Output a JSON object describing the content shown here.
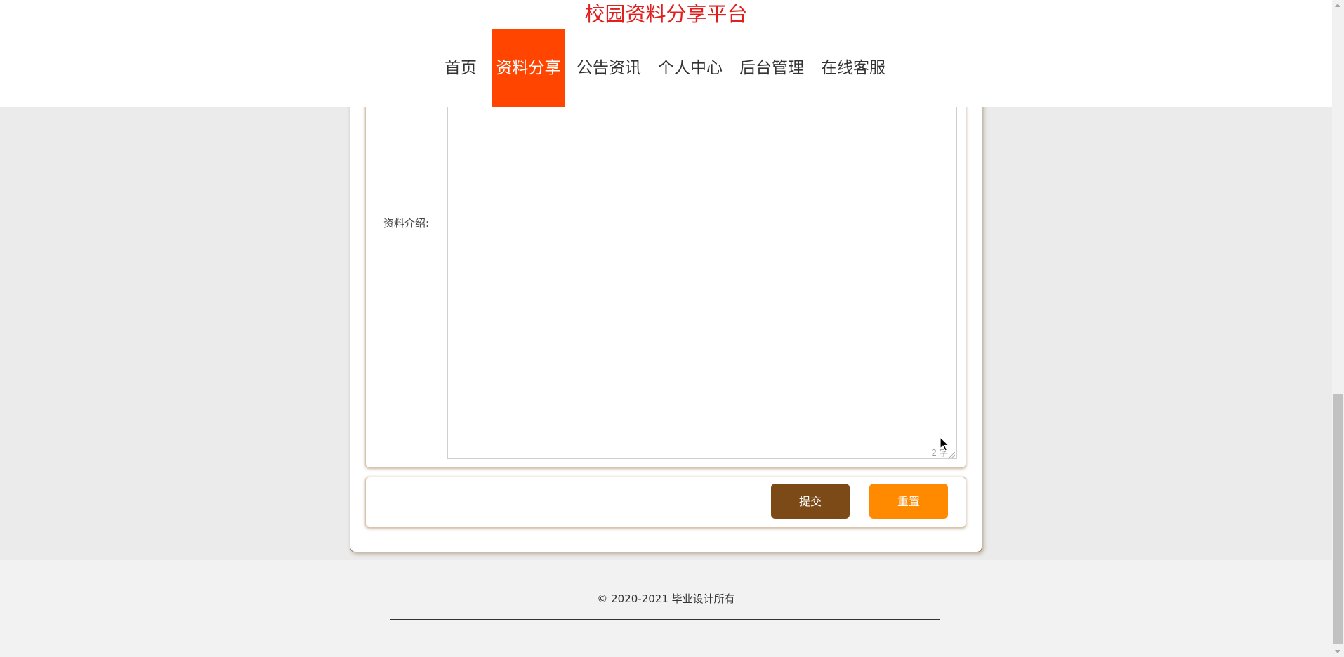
{
  "header": {
    "site_title": "校园资料分享平台",
    "nav": [
      {
        "label": "首页",
        "active": false
      },
      {
        "label": "资料分享",
        "active": true
      },
      {
        "label": "公告资讯",
        "active": false
      },
      {
        "label": "个人中心",
        "active": false
      },
      {
        "label": "后台管理",
        "active": false
      },
      {
        "label": "在线客服",
        "active": false
      }
    ],
    "accent_color": "#ff4500",
    "title_color": "#e0201f"
  },
  "form": {
    "intro_label": "资料介绍:",
    "editor_value": "",
    "word_count": "2 字",
    "submit_label": "提交",
    "reset_label": "重置",
    "submit_color": "#7b4a17",
    "reset_color": "#ff8a00"
  },
  "footer": {
    "copyright": "© 2020-2021 毕业设计所有"
  },
  "icons": {
    "cursor": "arrow-pointer-icon"
  }
}
